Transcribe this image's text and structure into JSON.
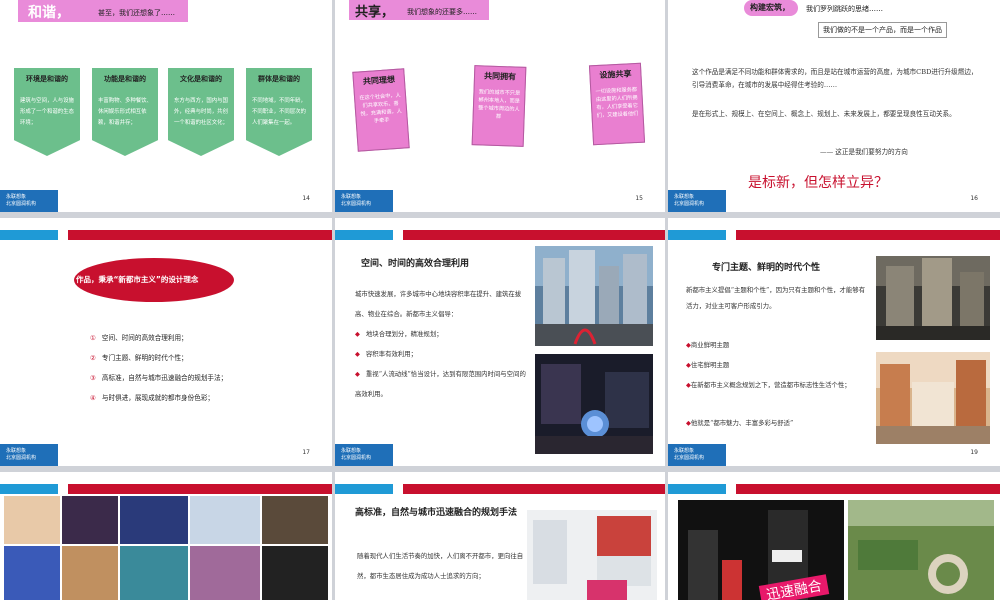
{
  "footer": {
    "line1": "永联想象",
    "line2": "北京圆润机构"
  },
  "slide1": {
    "title_big": "和谐，",
    "title_small": "甚至，我们还想象了……",
    "page": "14",
    "cards": [
      {
        "heading": "环境是和谐的",
        "body": "建筑与空间，人与设施形成了一个和谐的生态环境；"
      },
      {
        "heading": "功能是和谐的",
        "body": "丰富购物、多种餐饮、休闲娱乐形式相互依赖，和谐并存；"
      },
      {
        "heading": "文化是和谐的",
        "body": "东方与西方，国内与国外，经典与时尚，共创一个和谐的社区文化；"
      },
      {
        "heading": "群体是和谐的",
        "body": "不同地域，不同年龄，不同职业，不同层次的人们聚集在一起。"
      }
    ]
  },
  "slide2": {
    "title_big": "共享，",
    "title_small": "我们想象的还要多……",
    "page": "15",
    "notes": [
      {
        "heading": "共同理想",
        "body": "在这个社会中，人们共享欢乐、喜悦，充满和谐，人手牵手"
      },
      {
        "heading": "共同拥有",
        "body": "我们的城市不只是郴州本地人，而是整个城市周边的人群"
      },
      {
        "heading": "设施共享",
        "body": "一切设施和服务都由这里的人们所拥有，人们享受着它们，又建设着他们"
      }
    ]
  },
  "slide3": {
    "tag": "构建宏筑，",
    "subtitle": "我们罗列跳跃的思绪……",
    "boxed": "我们做的不是一个产品，而是一个作品",
    "para1": "这个作品是满足不同功能和群体需求的，而且是站在城市运营的高度，为城市CBD进行升级燃边，引导消费革命，在城市的发展中经得住考验的……",
    "para2": "是在形式上、规模上、在空间上、概念上、规划上、未来发展上，都要呈现良性互动关系。",
    "signature": "—— 这正是我们要努力的方向",
    "question": "是标新，但怎样立异？",
    "page": "16"
  },
  "slide4": {
    "oval_text": "作品，秉承“新都市主义”的设计理念",
    "items": [
      {
        "num": "①",
        "text": "空间、时间的高效合理利用；"
      },
      {
        "num": "②",
        "text": "专门主题、鲜明的时代个性；"
      },
      {
        "num": "③",
        "text": "高标准，自然与城市迅速融合的规划手法；"
      },
      {
        "num": "④",
        "text": "与时俱进，展现成就的都市身份色彩；"
      }
    ],
    "page": "17"
  },
  "slide5": {
    "heading": "空间、时间的高效合理利用",
    "intro": "城市快速发展，许多城市中心地块容积率在提升、建筑在拔高、物业在综合。新都市主义倡导：",
    "bullets": [
      "地块合理划分，精准规划；",
      "容积率有效利用；",
      "重视“人流动线”恰当设计，达到有限范围内时间与空间的高效利用。"
    ]
  },
  "slide6": {
    "heading": "专门主题、鲜明的时代个性",
    "intro": "新都市主义提倡“主题和个性”，因为只有主题和个性，才能够有活力，对业主可客户形成引力。",
    "bullets": [
      "商业鲜明主题",
      "住宅鲜明主题",
      "在新都市主义概念规划之下，营造都市标志性生活个性；",
      "他就是“都市魅力、丰富多彩与舒适”"
    ],
    "page": "19"
  },
  "slide8": {
    "heading": "高标准，自然与城市迅速融合的规划手法",
    "body": "随着现代人们生活节奏的加快，人们离不开都市，更向往自然，都市生态居住成为成功人士追求的方向；"
  },
  "slide9": {
    "banner": "迅速融合"
  },
  "colors": {
    "pink": "#e98bd9",
    "green": "#6cbf8c",
    "red": "#c8102e",
    "blue": "#1f9ad6"
  }
}
